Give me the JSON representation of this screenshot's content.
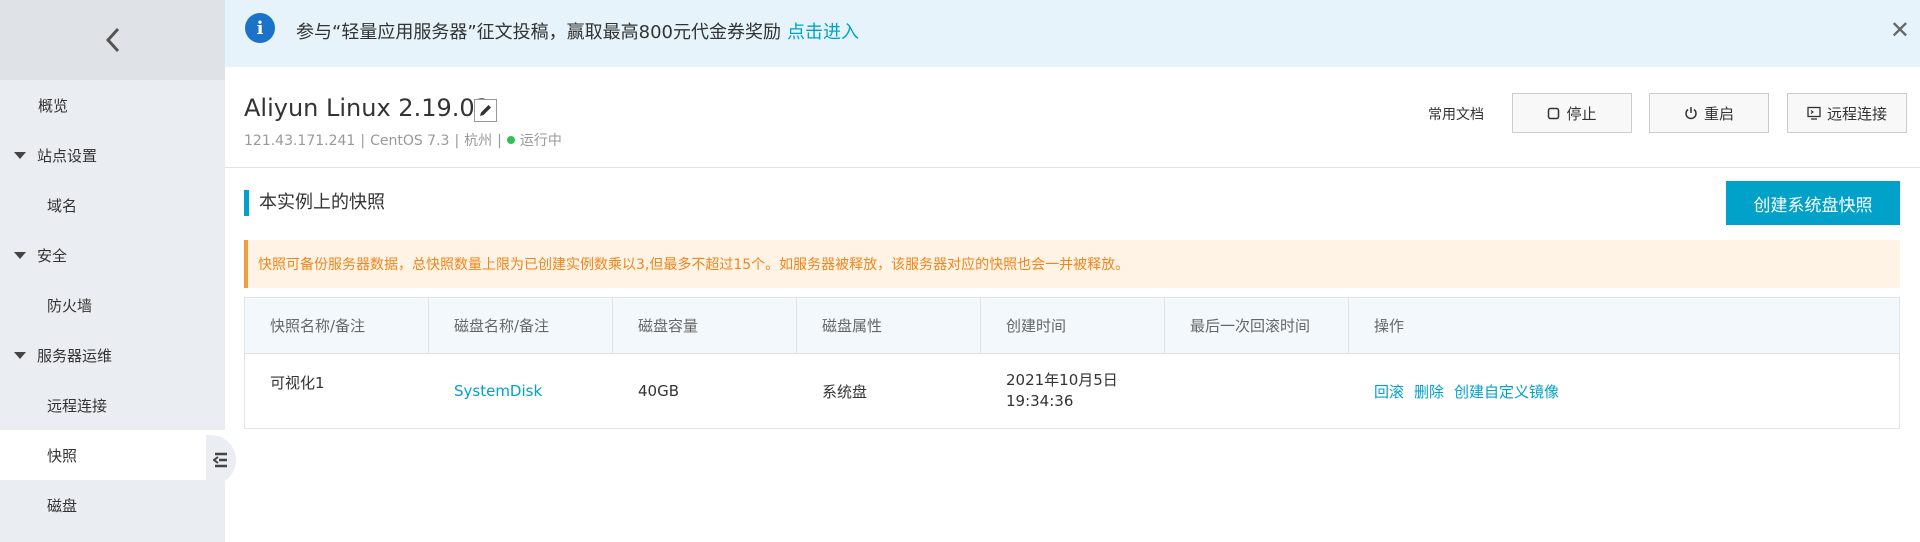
{
  "sidebar": {
    "items": [
      {
        "label": "概览"
      },
      {
        "label": "站点设置"
      },
      {
        "label": "域名"
      },
      {
        "label": "安全"
      },
      {
        "label": "防火墙"
      },
      {
        "label": "服务器运维"
      },
      {
        "label": "远程连接"
      },
      {
        "label": "快照"
      },
      {
        "label": "磁盘"
      }
    ]
  },
  "notice": {
    "text": "参与“轻量应用服务器”征文投稿，赢取最高800元代金券奖励",
    "link": "点击进入"
  },
  "header": {
    "title": "Aliyun Linux 2.19.03",
    "ip": "121.43.171.241",
    "os": "CentOS 7.3",
    "region": "杭州",
    "status": "运行中",
    "status_color": "#2fc25b",
    "docs": "常用文档",
    "stop": "停止",
    "restart": "重启",
    "remote": "远程连接"
  },
  "section": {
    "title": "本实例上的快照",
    "create_button": "创建系统盘快照",
    "warning": "快照可备份服务器数据，总快照数量上限为已创建实例数乘以3,但最多不超过15个。如服务器被释放，该服务器对应的快照也会一并被释放。"
  },
  "table": {
    "headers": [
      "快照名称/备注",
      "磁盘名称/备注",
      "磁盘容量",
      "磁盘属性",
      "创建时间",
      "最后一次回滚时间",
      "操作"
    ],
    "rows": [
      {
        "name": "可视化1",
        "disk": "SystemDisk",
        "capacity": "40GB",
        "attr": "系统盘",
        "date": "2021年10月5日",
        "time": "19:34:36",
        "last_rollback": "",
        "actions": [
          "回滚",
          "删除",
          "创建自定义镜像"
        ]
      }
    ]
  },
  "colors": {
    "accent": "#00a2ca",
    "warning": "#f0851c",
    "info": "#1a73c8"
  }
}
